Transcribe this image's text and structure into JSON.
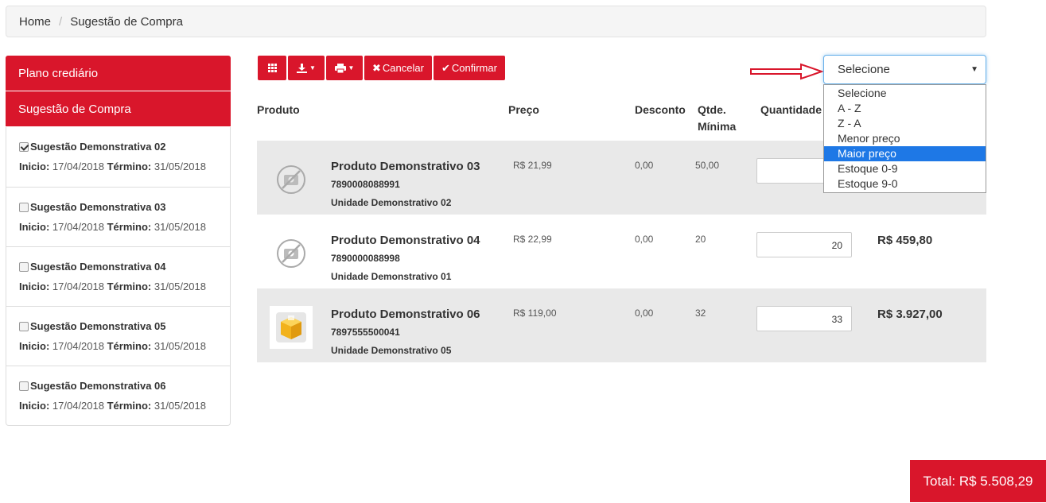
{
  "breadcrumb": {
    "home": "Home",
    "separator": "/",
    "current": "Sugestão de Compra"
  },
  "sidebar": {
    "menu": [
      "Plano crediário",
      "Sugestão de Compra"
    ],
    "start_label": "Inicio:",
    "end_label": "Término:",
    "items": [
      {
        "name": "Sugestão Demonstrativa 02",
        "checked": true,
        "start": "17/04/2018",
        "end": "31/05/2018"
      },
      {
        "name": "Sugestão Demonstrativa 03",
        "checked": false,
        "start": "17/04/2018",
        "end": "31/05/2018"
      },
      {
        "name": "Sugestão Demonstrativa 04",
        "checked": false,
        "start": "17/04/2018",
        "end": "31/05/2018"
      },
      {
        "name": "Sugestão Demonstrativa 05",
        "checked": false,
        "start": "17/04/2018",
        "end": "31/05/2018"
      },
      {
        "name": "Sugestão Demonstrativa 06",
        "checked": false,
        "start": "17/04/2018",
        "end": "31/05/2018"
      }
    ]
  },
  "toolbar": {
    "cancel_label": "Cancelar",
    "confirm_label": "Confirmar"
  },
  "sort": {
    "selected": "Selecione",
    "highlighted": "Maior preço",
    "options": [
      "Selecione",
      "A - Z",
      "Z - A",
      "Menor preço",
      "Maior preço",
      "Estoque 0-9",
      "Estoque 9-0"
    ]
  },
  "table": {
    "headers": {
      "produto": "Produto",
      "preco": "Preço",
      "desconto": "Desconto",
      "qtde_minima": "Qtde.\nMínima",
      "quantidade": "Quantidade"
    },
    "rows": [
      {
        "name": "Produto Demonstrativo 03",
        "code": "7890008088991",
        "unit": "Unidade Demonstrativo 02",
        "price": "R$ 21,99",
        "discount": "0,00",
        "min_qty": "50,00",
        "quantity": "5",
        "subtotal": "",
        "image": "no-image-icon"
      },
      {
        "name": "Produto Demonstrativo 04",
        "code": "7890000088998",
        "unit": "Unidade Demonstrativo 01",
        "price": "R$ 22,99",
        "discount": "0,00",
        "min_qty": "20",
        "quantity": "20",
        "subtotal": "R$ 459,80",
        "image": "no-image-icon"
      },
      {
        "name": "Produto Demonstrativo 06",
        "code": "7897555500041",
        "unit": "Unidade Demonstrativo 05",
        "price": "R$ 119,00",
        "discount": "0,00",
        "min_qty": "32",
        "quantity": "33",
        "subtotal": "R$ 3.927,00",
        "image": "product-photo"
      }
    ]
  },
  "total": "Total: R$ 5.508,29",
  "colors": {
    "primary": "#d9162b",
    "highlight": "#1e78e6",
    "row_alt": "#e9e9e9"
  }
}
